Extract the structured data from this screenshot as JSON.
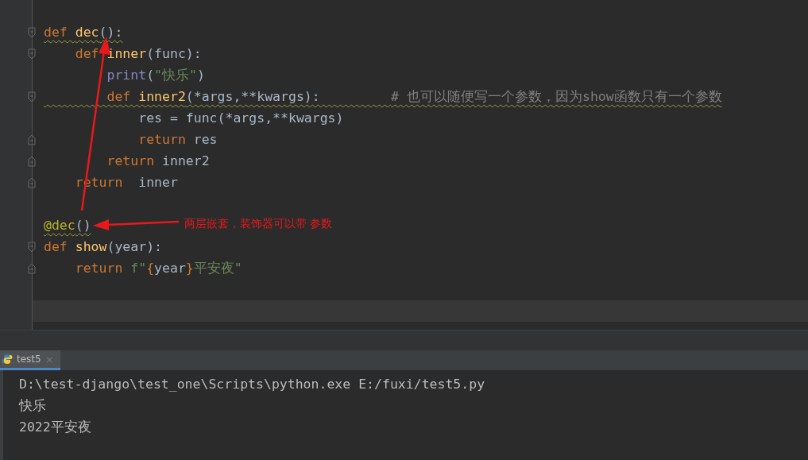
{
  "editor": {
    "lines": [
      {
        "blank_before": true,
        "fold_start": true,
        "warning": true,
        "tokens": [
          {
            "kind": "keyword",
            "text": "def "
          },
          {
            "kind": "function",
            "text": "dec"
          },
          {
            "kind": "plain",
            "text": "():"
          }
        ]
      },
      {
        "fold_start": true,
        "tokens": [
          {
            "kind": "keyword",
            "text": "    def "
          },
          {
            "kind": "function",
            "text": "inner"
          },
          {
            "kind": "plain",
            "text": "(func):"
          }
        ]
      },
      {
        "tokens": [
          {
            "kind": "builtin",
            "text": "        print"
          },
          {
            "kind": "plain",
            "text": "("
          },
          {
            "kind": "string",
            "text": "\"快乐\""
          },
          {
            "kind": "plain",
            "text": ")"
          }
        ]
      },
      {
        "fold_start": true,
        "warning": true,
        "tokens": [
          {
            "kind": "keyword",
            "text": "        def "
          },
          {
            "kind": "function",
            "text": "inner2"
          },
          {
            "kind": "plain",
            "text": "(*args,**kwargs):         "
          },
          {
            "kind": "comment",
            "text": "# 也可以随便写一个参数，因为show函数只有一个参数"
          }
        ]
      },
      {
        "tokens": [
          {
            "kind": "plain",
            "text": "            res = func(*args,**kwargs)"
          }
        ]
      },
      {
        "fold_end": true,
        "tokens": [
          {
            "kind": "keyword",
            "text": "            return "
          },
          {
            "kind": "plain",
            "text": "res"
          }
        ]
      },
      {
        "fold_end": true,
        "tokens": [
          {
            "kind": "keyword",
            "text": "        return "
          },
          {
            "kind": "plain",
            "text": "inner2"
          }
        ]
      },
      {
        "fold_end": true,
        "tokens": [
          {
            "kind": "keyword",
            "text": "    return  "
          },
          {
            "kind": "plain",
            "text": "inner"
          }
        ]
      },
      {
        "blank_before": true,
        "warning": true,
        "tokens": [
          {
            "kind": "decorator",
            "text": "@dec"
          },
          {
            "kind": "plain",
            "text": "()"
          }
        ]
      },
      {
        "fold_start": true,
        "tokens": [
          {
            "kind": "keyword",
            "text": "def "
          },
          {
            "kind": "function",
            "text": "show"
          },
          {
            "kind": "plain",
            "text": "(year):"
          }
        ]
      },
      {
        "fold_end": true,
        "tokens": [
          {
            "kind": "keyword",
            "text": "    return "
          },
          {
            "kind": "string",
            "text": "f\""
          },
          {
            "kind": "keyword",
            "text": "{"
          },
          {
            "kind": "plain",
            "text": "year"
          },
          {
            "kind": "keyword",
            "text": "}"
          },
          {
            "kind": "string",
            "text": "平安夜\""
          }
        ]
      },
      {
        "blank_before": true,
        "current": true
      }
    ],
    "annotation": "两层嵌套，装饰器可以带 参数"
  },
  "run_panel": {
    "tab": {
      "label": "test5",
      "close": "×",
      "selected": true
    },
    "output": [
      "D:\\test-django\\test_one\\Scripts\\python.exe E:/fuxi/test5.py",
      "快乐",
      "2022平安夜"
    ]
  }
}
